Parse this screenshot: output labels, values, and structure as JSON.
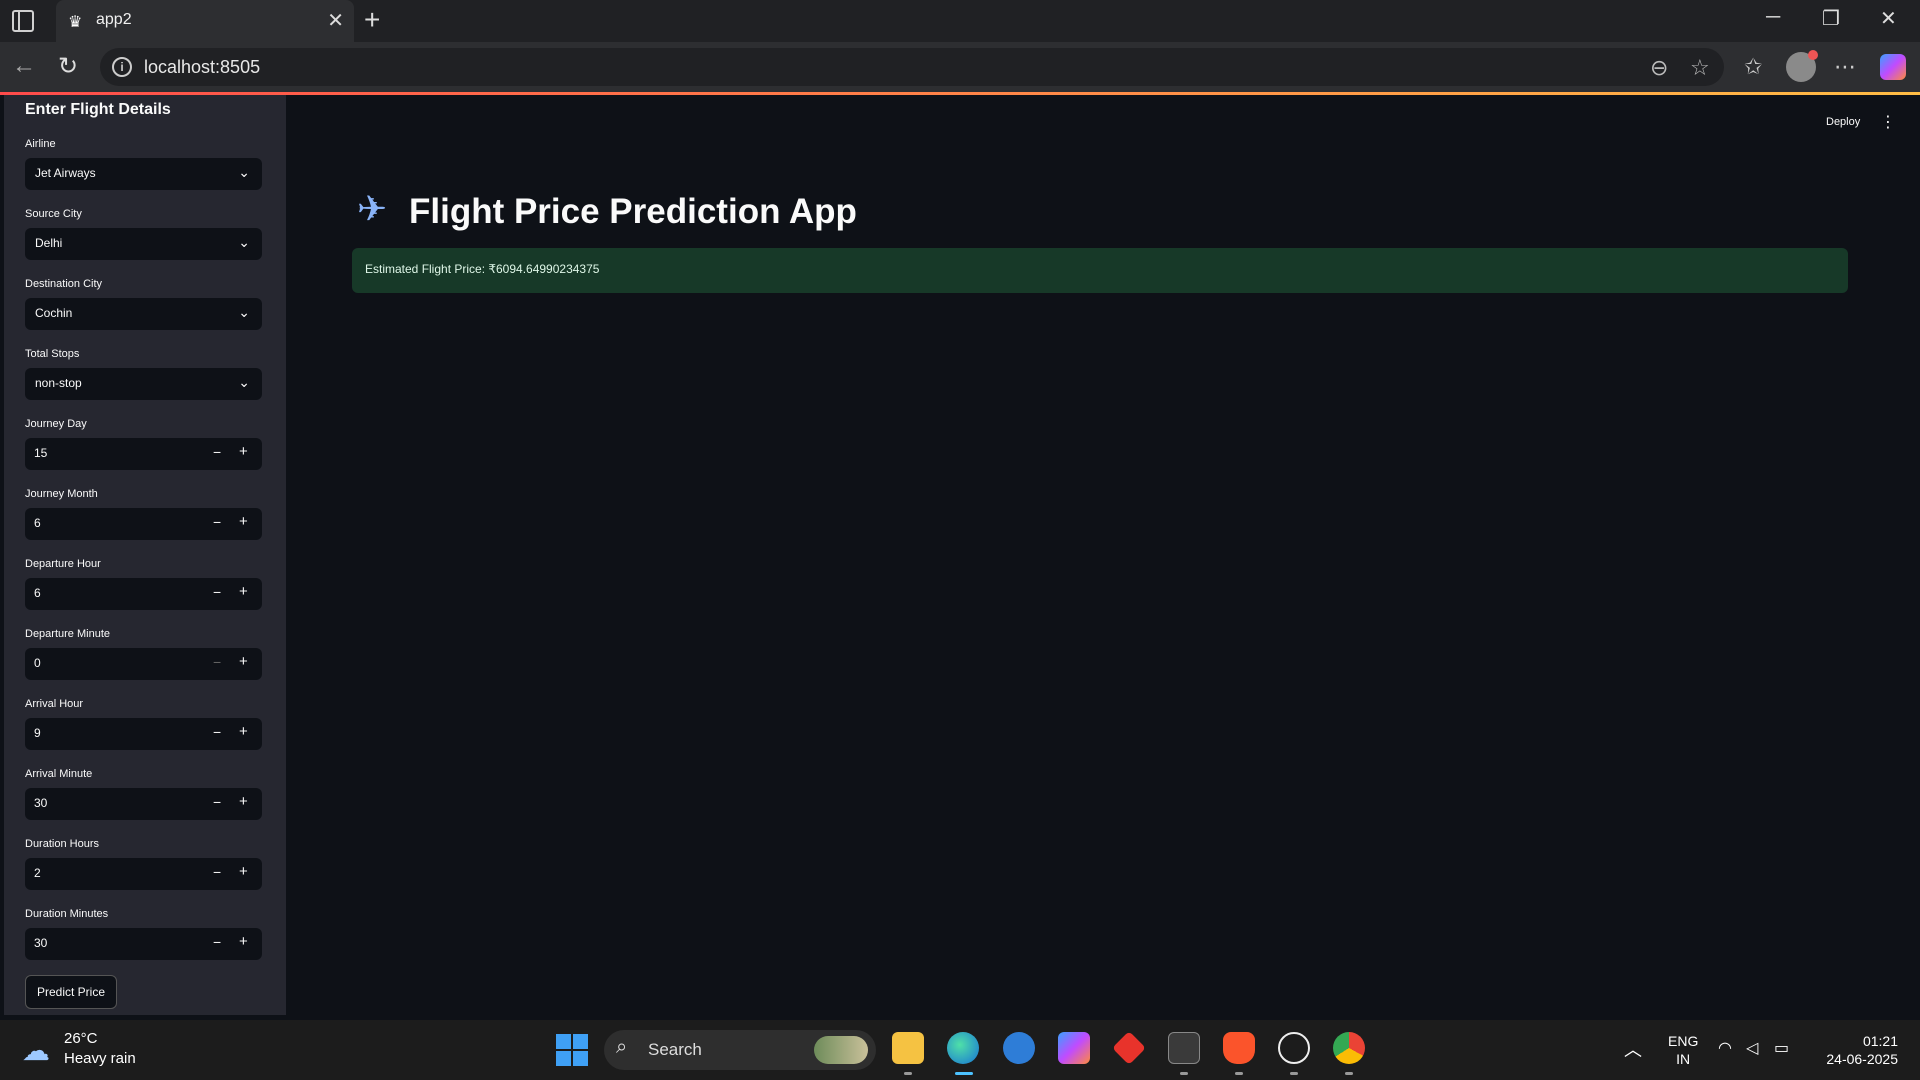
{
  "browser": {
    "tab_title": "app2",
    "url": "localhost:8505"
  },
  "sidebar": {
    "header": "Enter Flight Details",
    "selects": [
      {
        "label": "Airline",
        "value": "Jet Airways"
      },
      {
        "label": "Source City",
        "value": "Delhi"
      },
      {
        "label": "Destination City",
        "value": "Cochin"
      },
      {
        "label": "Total Stops",
        "value": "non-stop"
      }
    ],
    "numbers": [
      {
        "label": "Journey Day",
        "value": "15"
      },
      {
        "label": "Journey Month",
        "value": "6"
      },
      {
        "label": "Departure Hour",
        "value": "6"
      },
      {
        "label": "Departure Minute",
        "value": "0"
      },
      {
        "label": "Arrival Hour",
        "value": "9"
      },
      {
        "label": "Arrival Minute",
        "value": "30"
      },
      {
        "label": "Duration Hours",
        "value": "2"
      },
      {
        "label": "Duration Minutes",
        "value": "30"
      }
    ],
    "stepper_minus": "−",
    "stepper_plus": "+",
    "predict_button": "Predict Price"
  },
  "main": {
    "deploy_label": "Deploy",
    "title": "Flight Price Prediction App",
    "result": "Estimated Flight Price: ₹6094.64990234375"
  },
  "taskbar": {
    "weather_temp": "26°C",
    "weather_desc": "Heavy rain",
    "search_label": "Search",
    "lang_line1": "ENG",
    "lang_line2": "IN",
    "time": "01:21",
    "date": "24-06-2025"
  },
  "colors": {
    "app_bg": "#0e1117",
    "sidebar_bg": "#262730",
    "success_bg": "#173928",
    "accent": "#ff4b4b"
  }
}
